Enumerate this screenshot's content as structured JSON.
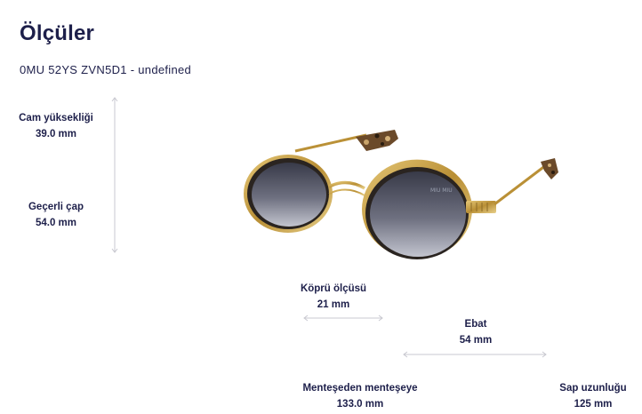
{
  "header": {
    "title": "Ölçüler",
    "subtitle": "0MU 52YS ZVN5D1 - undefined"
  },
  "measurements": {
    "lens_height": {
      "label": "Cam yüksekliği",
      "value": "39.0 mm"
    },
    "diameter": {
      "label": "Geçerli çap",
      "value": "54.0 mm"
    },
    "bridge": {
      "label": "Köprü ölçüsü",
      "value": "21 mm"
    },
    "size": {
      "label": "Ebat",
      "value": "54 mm"
    },
    "hinge_to_hinge": {
      "label": "Menteşeden menteşeye",
      "value": "133.0 mm"
    },
    "temple_length": {
      "label": "Sap uzunluğu",
      "value": "125 mm"
    }
  },
  "product_image": {
    "lens_brand_mark": "MIU MIU",
    "colors": {
      "frame_gold": "#c9a24a",
      "frame_dark": "#2a2420",
      "lens_gradient_top": "#3f4150",
      "lens_gradient_bottom": "#b9bcc8",
      "tortoise": "#6b4a2a"
    }
  },
  "colors": {
    "text": "#1d1f4a",
    "arrow": "#c8c8d0"
  }
}
